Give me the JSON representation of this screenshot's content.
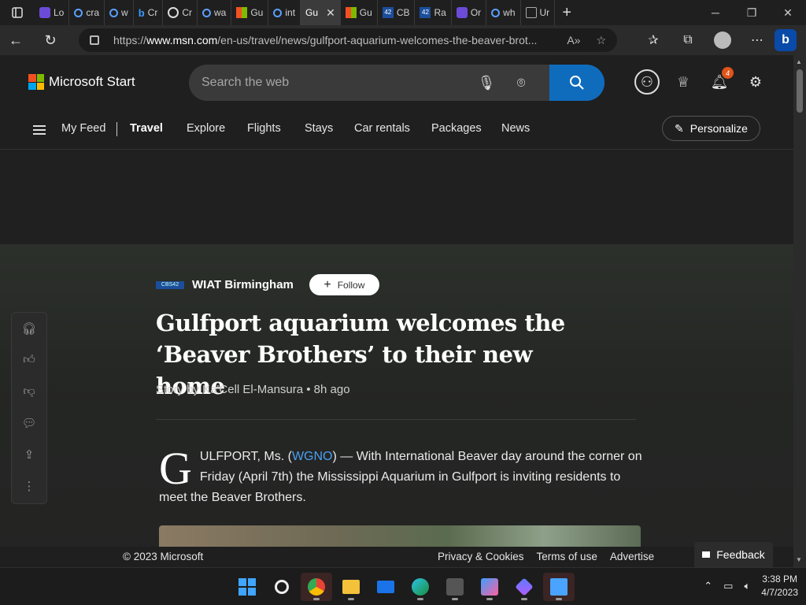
{
  "browser": {
    "tabs": [
      {
        "label": "Lo",
        "icon": "purple"
      },
      {
        "label": "cra",
        "icon": "search"
      },
      {
        "label": "w",
        "icon": "search"
      },
      {
        "label": "Cr",
        "icon": "bing"
      },
      {
        "label": "Cr",
        "icon": "ai"
      },
      {
        "label": "wa",
        "icon": "search"
      },
      {
        "label": "Gu",
        "icon": "ms"
      },
      {
        "label": "int",
        "icon": "search"
      },
      {
        "label": "Gu",
        "icon": "none",
        "active": true
      },
      {
        "label": "Gu",
        "icon": "ms"
      },
      {
        "label": "CB",
        "icon": "cbs"
      },
      {
        "label": "Ra",
        "icon": "cbs"
      },
      {
        "label": "Or",
        "icon": "purple"
      },
      {
        "label": "wh",
        "icon": "search"
      },
      {
        "label": "Ur",
        "icon": "doc"
      }
    ],
    "cbs_favicon_text": "42",
    "url_prefix": "https://",
    "url_domain": "www.msn.com",
    "url_path": "/en-us/travel/news/gulfport-aquarium-welcomes-the-beaver-brot..."
  },
  "header": {
    "brand": "Microsoft Start",
    "search_placeholder": "Search the web",
    "notification_count": "4"
  },
  "nav": {
    "items": [
      "My Feed",
      "Travel",
      "Explore",
      "Flights",
      "Stays",
      "Car rentals",
      "Packages",
      "News"
    ],
    "active": "Travel",
    "personalize": "Personalize"
  },
  "article": {
    "source_logo_text": "CBS42",
    "source": "WIAT Birmingham",
    "follow": "Follow",
    "headline": "Gulfport aquarium welcomes the ‘Beaver Brothers’ to their new home",
    "byline": "Story by Ka'Cell El-Mansura • 8h ago",
    "dropcap": "G",
    "body_before_link": "ULFPORT, Ms. (",
    "body_link": "WGNO",
    "body_after_link": ") — With International Beaver day around the corner on Friday (April 7th) the Mississippi Aquarium in Gulfport is inviting residents to meet the Beaver Brothers."
  },
  "footer": {
    "copyright": "© 2023 Microsoft",
    "links": [
      "Privacy & Cookies",
      "Terms of use",
      "Advertise"
    ],
    "feedback": "Feedback"
  },
  "taskbar": {
    "time": "3:38 PM",
    "date": "4/7/2023"
  },
  "colors": {
    "accent": "#0f6cbd",
    "link": "#4a9ff5",
    "badge": "#e0541a"
  }
}
